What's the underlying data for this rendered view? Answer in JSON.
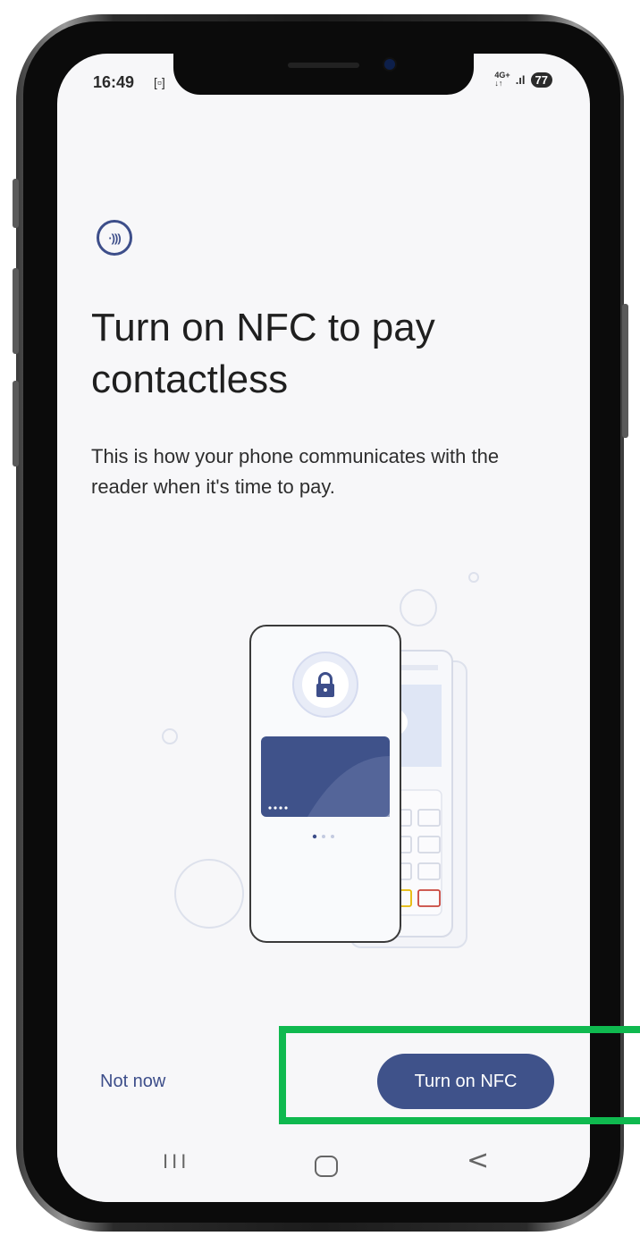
{
  "status_bar": {
    "time": "16:49",
    "screenshot_indicator": "[▫]",
    "network_type": "4G+",
    "network_arrows": "↓↑",
    "signal": ".ıl",
    "battery": "77"
  },
  "content": {
    "nfc_icon_glyph": "·)))",
    "title": "Turn on NFC to pay contactless",
    "description": "This is how your phone communicates with the reader when it's time to pay.",
    "illustration_contactless_glyph": "·)))"
  },
  "actions": {
    "not_now_label": "Not now",
    "turn_on_label": "Turn on NFC"
  },
  "nav_bar": {
    "recent_glyph": "III",
    "back_glyph": "<"
  },
  "colors": {
    "accent": "#3f528a",
    "highlight": "#0fb94f",
    "background": "#f7f7f9"
  }
}
